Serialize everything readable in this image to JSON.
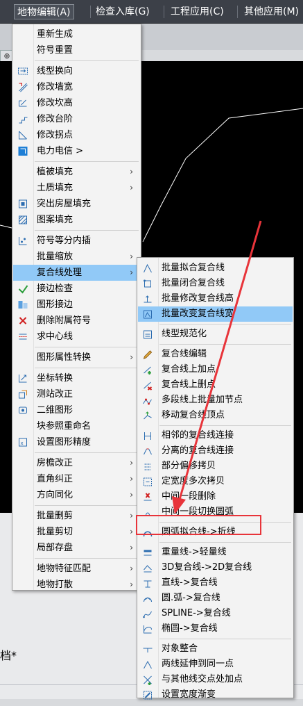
{
  "menubar": {
    "items": [
      {
        "label": "地物编辑(A)",
        "active": true
      },
      {
        "label": "检查入库(G)",
        "active": false
      },
      {
        "label": "工程应用(C)",
        "active": false
      },
      {
        "label": "其他应用(M)",
        "active": false
      }
    ]
  },
  "background": {
    "text": "档*",
    "tab": "⊕"
  },
  "menu1": {
    "items": [
      {
        "label": "重新生成",
        "icon": "",
        "submenu": false
      },
      {
        "label": "符号重置",
        "icon": "",
        "submenu": false
      },
      {
        "sep": true
      },
      {
        "label": "线型换向",
        "icon": "line-reverse-icon",
        "submenu": false
      },
      {
        "label": "修改墙宽",
        "icon": "wall-width-icon",
        "submenu": false
      },
      {
        "label": "修改坎高",
        "icon": "ridge-height-icon",
        "submenu": false
      },
      {
        "label": "修改台阶",
        "icon": "steps-icon",
        "submenu": false
      },
      {
        "label": "修改拐点",
        "icon": "corner-point-icon",
        "submenu": false
      },
      {
        "label": "电力电信 >",
        "icon": "power-telecom-icon",
        "submenu": false
      },
      {
        "sep": true
      },
      {
        "label": "植被填充",
        "icon": "",
        "submenu": true
      },
      {
        "label": "土质填充",
        "icon": "",
        "submenu": true
      },
      {
        "label": "突出房屋填充",
        "icon": "house-fill-icon",
        "submenu": false
      },
      {
        "label": "图案填充",
        "icon": "pattern-fill-icon",
        "submenu": false
      },
      {
        "sep": true
      },
      {
        "label": "符号等分内插",
        "icon": "symbol-interpolate-icon",
        "submenu": false
      },
      {
        "label": "批量缩放",
        "icon": "",
        "submenu": true
      },
      {
        "label": "复合线处理",
        "icon": "",
        "submenu": true,
        "highlighted": true
      },
      {
        "label": "接边检查",
        "icon": "edge-check-icon",
        "submenu": false
      },
      {
        "label": "图形接边",
        "icon": "graphic-join-icon",
        "submenu": false
      },
      {
        "label": "删除附属符号",
        "icon": "delete-symbol-icon",
        "submenu": false
      },
      {
        "label": "求中心线",
        "icon": "centerline-icon",
        "submenu": false
      },
      {
        "sep": true
      },
      {
        "label": "图形属性转换",
        "icon": "",
        "submenu": true
      },
      {
        "sep": true
      },
      {
        "label": "坐标转换",
        "icon": "coordinate-transform-icon",
        "submenu": false
      },
      {
        "label": "测站改正",
        "icon": "station-correct-icon",
        "submenu": false
      },
      {
        "label": "二维图形",
        "icon": "2d-graphic-icon",
        "submenu": false
      },
      {
        "label": "块参照重命名",
        "icon": "",
        "submenu": false
      },
      {
        "label": "设置图形精度",
        "icon": "precision-icon",
        "submenu": false
      },
      {
        "sep": true
      },
      {
        "label": "房檐改正",
        "icon": "",
        "submenu": true
      },
      {
        "label": "直角纠正",
        "icon": "",
        "submenu": true
      },
      {
        "label": "方向同化",
        "icon": "",
        "submenu": true
      },
      {
        "sep": true
      },
      {
        "label": "批量删剪",
        "icon": "",
        "submenu": true
      },
      {
        "label": "批量剪切",
        "icon": "",
        "submenu": true
      },
      {
        "label": "局部存盘",
        "icon": "",
        "submenu": true
      },
      {
        "sep": true
      },
      {
        "label": "地物特征匹配",
        "icon": "",
        "submenu": true
      },
      {
        "label": "地物打散",
        "icon": "",
        "submenu": true
      }
    ]
  },
  "menu2": {
    "items": [
      {
        "label": "批量拟合复合线",
        "icon": "fit-polyline-icon"
      },
      {
        "label": "批量闭合复合线",
        "icon": "close-polyline-icon"
      },
      {
        "label": "批量修改复合线高",
        "icon": "polyline-height-icon"
      },
      {
        "label": "批量改变复合线宽",
        "icon": "polyline-width-icon",
        "highlighted": true
      },
      {
        "sep": true
      },
      {
        "label": "线型规范化",
        "icon": "linetype-normalize-icon"
      },
      {
        "sep": true
      },
      {
        "label": "复合线编辑",
        "icon": "polyline-edit-icon"
      },
      {
        "label": "复合线上加点",
        "icon": "add-point-icon"
      },
      {
        "label": "复合线上删点",
        "icon": "delete-point-icon"
      },
      {
        "label": "多段线上批量加节点",
        "icon": "batch-add-node-icon"
      },
      {
        "label": "移动复合线顶点",
        "icon": "move-vertex-icon"
      },
      {
        "sep": true
      },
      {
        "label": "相邻的复合线连接",
        "icon": "join-adjacent-icon"
      },
      {
        "label": "分离的复合线连接",
        "icon": "join-separate-icon"
      },
      {
        "label": "部分偏移拷贝",
        "icon": "offset-copy-icon"
      },
      {
        "label": "定宽度多次拷贝",
        "icon": "width-copy-icon"
      },
      {
        "label": "中间一段删除",
        "icon": "delete-segment-icon"
      },
      {
        "label": "中间一段切换圆弧",
        "icon": "arc-segment-icon"
      },
      {
        "sep": true
      },
      {
        "label": "圆弧拟合线->折线",
        "icon": "arc-to-polyline-icon"
      },
      {
        "sep": true
      },
      {
        "label": "重量线->轻量线",
        "icon": "heavy-to-light-icon"
      },
      {
        "label": "3D复合线->2D复合线",
        "icon": "3d-to-2d-icon"
      },
      {
        "label": "直线->复合线",
        "icon": "line-to-polyline-icon"
      },
      {
        "label": "圆.弧->复合线",
        "icon": "arc-to-pline-icon"
      },
      {
        "label": "SPLINE->复合线",
        "icon": "spline-to-pline-icon"
      },
      {
        "label": "椭圆->复合线",
        "icon": "ellipse-to-pline-icon"
      },
      {
        "sep": true
      },
      {
        "label": "对象整合",
        "icon": "object-merge-icon"
      },
      {
        "label": "两线延伸到同一点",
        "icon": "extend-two-lines-icon"
      },
      {
        "label": "与其他线交点处加点",
        "icon": "intersection-point-icon"
      },
      {
        "label": "设置宽度渐变",
        "icon": "width-gradient-icon"
      }
    ]
  },
  "colors": {
    "highlight": "#91c9f7",
    "annotation": "#e8343a",
    "menubar": "#3c4048",
    "icon_blue": "#2b6cb0"
  }
}
